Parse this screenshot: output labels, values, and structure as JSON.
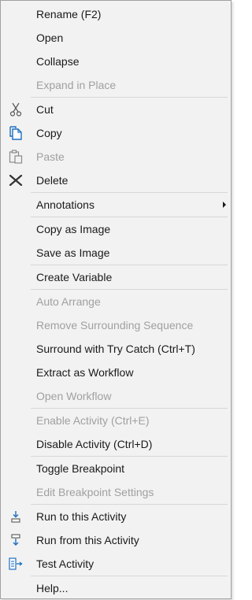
{
  "menu": {
    "rename": "Rename (F2)",
    "open": "Open",
    "collapse": "Collapse",
    "expand_in_place": "Expand in Place",
    "cut": "Cut",
    "copy": "Copy",
    "paste": "Paste",
    "delete": "Delete",
    "annotations": "Annotations",
    "copy_as_image": "Copy as Image",
    "save_as_image": "Save as Image",
    "create_variable": "Create Variable",
    "auto_arrange": "Auto Arrange",
    "remove_surrounding_sequence": "Remove Surrounding Sequence",
    "surround_try_catch": "Surround with Try Catch (Ctrl+T)",
    "extract_as_workflow": "Extract as Workflow",
    "open_workflow": "Open Workflow",
    "enable_activity": "Enable Activity (Ctrl+E)",
    "disable_activity": "Disable Activity (Ctrl+D)",
    "toggle_breakpoint": "Toggle Breakpoint",
    "edit_breakpoint_settings": "Edit Breakpoint Settings",
    "run_to_activity": "Run to this Activity",
    "run_from_activity": "Run from this Activity",
    "test_activity": "Test Activity",
    "help": "Help..."
  },
  "icons": {
    "cut": "scissors-icon",
    "copy": "copy-icon",
    "paste": "clipboard-icon",
    "delete": "x-delete-icon",
    "run_to": "run-to-icon",
    "run_from": "run-from-icon",
    "test": "test-activity-icon"
  },
  "colors": {
    "menu_bg": "#f2f2f2",
    "text": "#1a1a1a",
    "disabled_text": "#a0a0a0",
    "separator": "#d7d7d7",
    "accent_blue": "#1e6fbf"
  }
}
